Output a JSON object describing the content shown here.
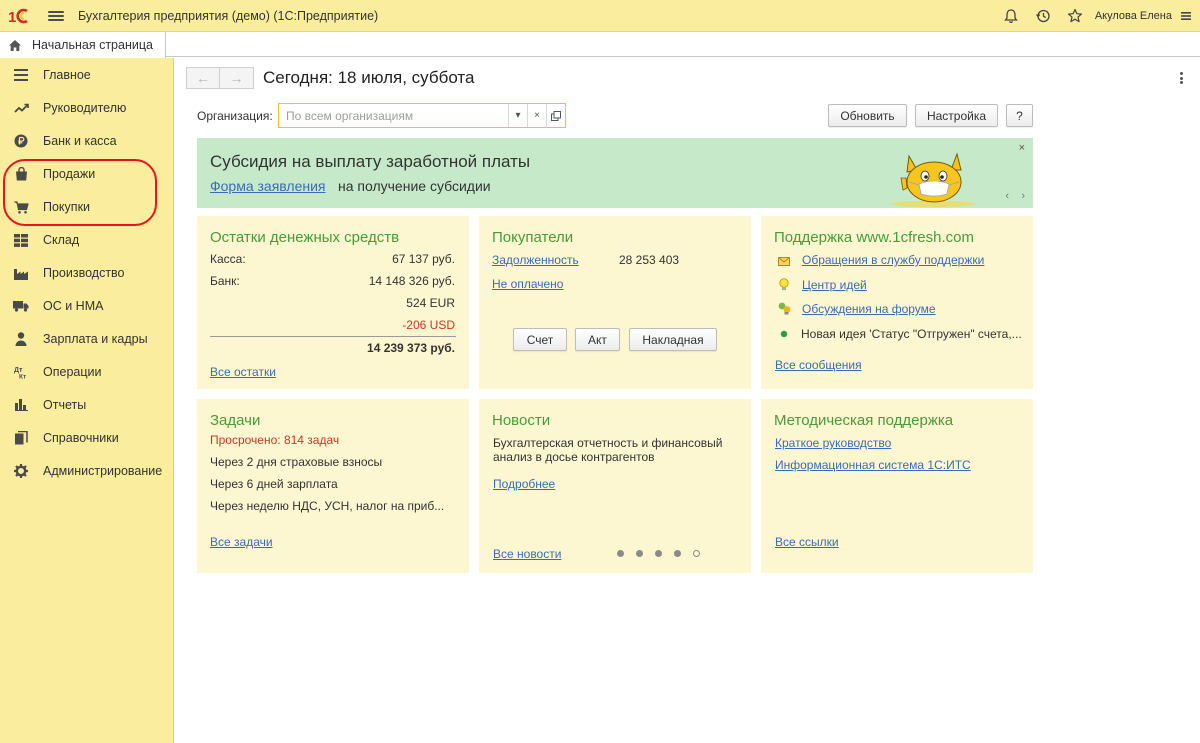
{
  "app": {
    "title": "Бухгалтерия предприятия (демо)  (1С:Предприятие)",
    "user": "Акулова Елена"
  },
  "tabs": {
    "home": "Начальная страница"
  },
  "sidebar": {
    "items": [
      {
        "label": "Главное",
        "icon": "menu-icon"
      },
      {
        "label": "Руководителю",
        "icon": "trend-icon"
      },
      {
        "label": "Банк и касса",
        "icon": "ruble-coin-icon"
      },
      {
        "label": "Продажи",
        "icon": "shopping-bag-icon"
      },
      {
        "label": "Покупки",
        "icon": "cart-icon"
      },
      {
        "label": "Склад",
        "icon": "warehouse-icon"
      },
      {
        "label": "Производство",
        "icon": "factory-icon"
      },
      {
        "label": "ОС и НМА",
        "icon": "truck-icon"
      },
      {
        "label": "Зарплата и кадры",
        "icon": "person-icon"
      },
      {
        "label": "Операции",
        "icon": "debit-credit-icon"
      },
      {
        "label": "Отчеты",
        "icon": "bar-chart-icon"
      },
      {
        "label": "Справочники",
        "icon": "books-icon"
      },
      {
        "label": "Администрирование",
        "icon": "gear-icon"
      }
    ],
    "highlight_color": "#e8141a"
  },
  "main": {
    "title": "Сегодня: 18 июля, суббота",
    "org_label": "Организация:",
    "org_placeholder": "По всем организациям",
    "refresh_button": "Обновить",
    "settings_button": "Настройка",
    "help_button": "?"
  },
  "banner": {
    "title": "Субсидия на выплату заработной платы",
    "link": "Форма заявления",
    "text": "на получение субсидии",
    "close": "×",
    "prev": "‹",
    "next": "›"
  },
  "cash": {
    "title": "Остатки денежных средств",
    "kassa_label": "Касса:",
    "kassa_value": "67 137 руб.",
    "bank_label": "Банк:",
    "bank_value_rub": "14 148 326 руб.",
    "bank_value_eur": "524 EUR",
    "bank_value_usd": "-206 USD",
    "total": "14 239 373 руб.",
    "all_link": "Все остатки"
  },
  "buyers": {
    "title": "Покупатели",
    "debt_link": "Задолженность",
    "debt_value": "28 253 403",
    "unpaid_link": "Не оплачено",
    "btn_invoice": "Счет",
    "btn_act": "Акт",
    "btn_waybill": "Накладная"
  },
  "support": {
    "title": "Поддержка www.1cfresh.com",
    "link1": "Обращения в службу поддержки",
    "link2": "Центр идей",
    "link3": "Обсуждения на форуме",
    "idea_text": "Новая идея 'Статус \"Отгружен\" счета,...",
    "all_link": "Все сообщения"
  },
  "tasks": {
    "title": "Задачи",
    "overdue": "Просрочено: 814 задач",
    "item1": "Через 2 дня страховые взносы",
    "item2": "Через 6 дней зарплата",
    "item3": "Через неделю НДС, УСН, налог на приб...",
    "all_link": "Все задачи"
  },
  "news": {
    "title": "Новости",
    "line1": "Бухгалтерская отчетность и финансовый",
    "line2": "анализ в досье контрагентов",
    "more_link": "Подробнее",
    "all_link": "Все новости",
    "carousel_total": 5,
    "carousel_current": 5
  },
  "method": {
    "title": "Методическая поддержка",
    "link1": "Краткое руководство",
    "link2": "Информационная система 1С:ИТС",
    "all_link": "Все ссылки"
  },
  "colors": {
    "app_yellow": "#fbed9e",
    "panel_bg": "#fcf7d0",
    "banner_bg": "#c6e9c9",
    "panel_title": "#4a9a3a",
    "link": "#3b6bb8",
    "negative": "#c0392b",
    "field_focus": "#f2c02e"
  }
}
